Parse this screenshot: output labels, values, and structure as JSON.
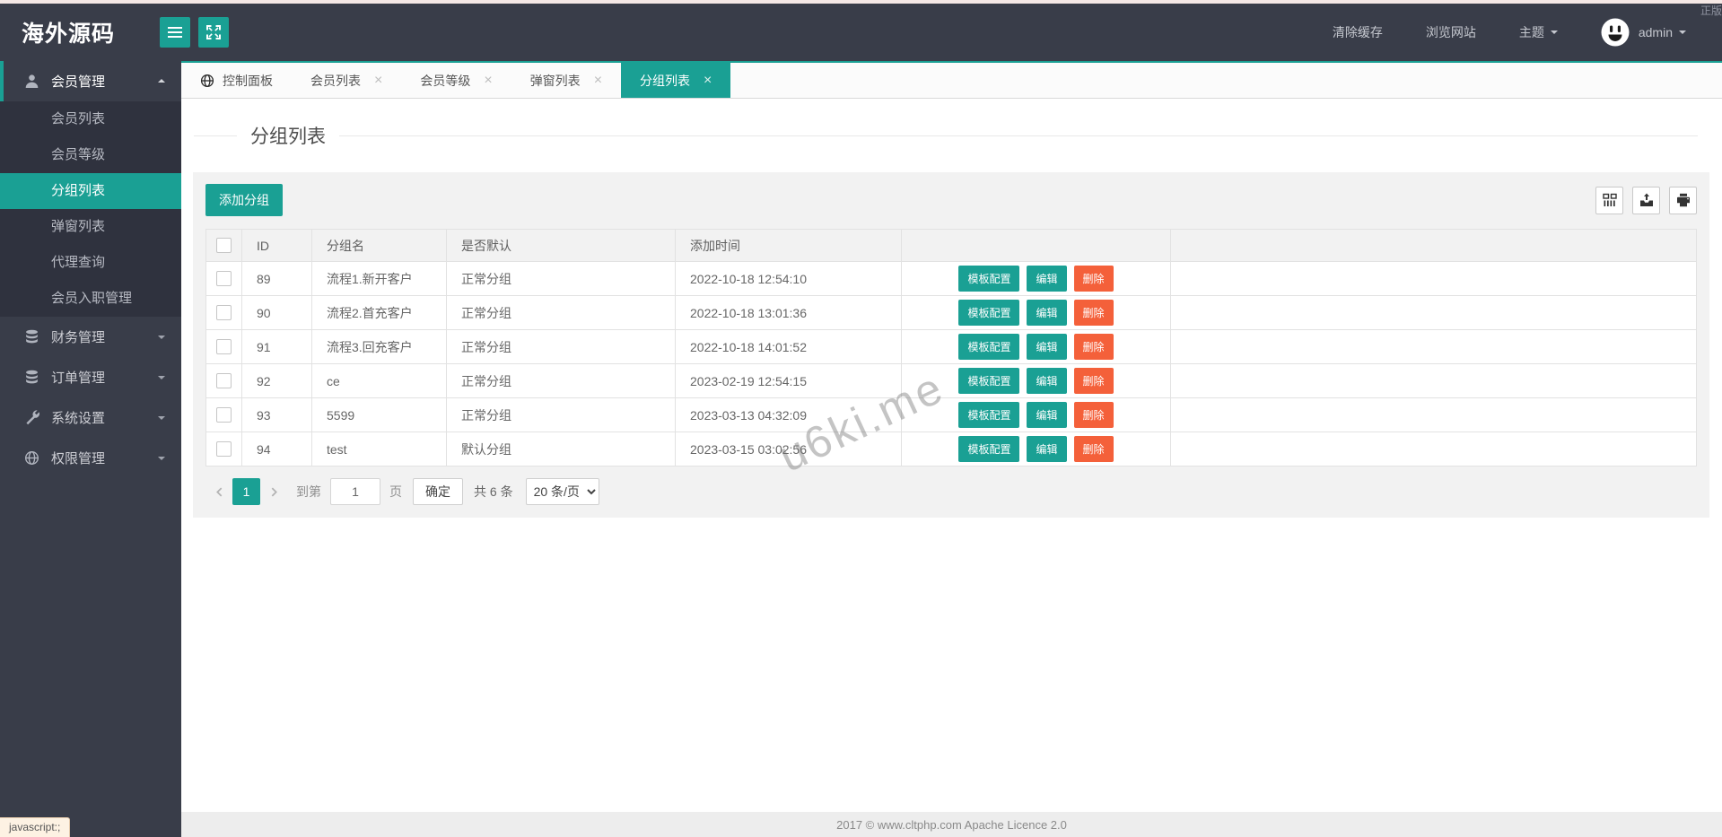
{
  "topbar": {
    "logo": "海外源码",
    "corner_text": "正版",
    "clear_cache": "清除缓存",
    "view_site": "浏览网站",
    "theme_label": "主题",
    "username": "admin"
  },
  "sidebar": {
    "sections": [
      {
        "key": "member-management",
        "label": "会员管理",
        "icon": "user-icon",
        "expanded": true,
        "active": true,
        "children": [
          {
            "key": "member-list",
            "label": "会员列表",
            "active": false
          },
          {
            "key": "member-level",
            "label": "会员等级",
            "active": false
          },
          {
            "key": "group-list",
            "label": "分组列表",
            "active": true
          },
          {
            "key": "popup-list",
            "label": "弹窗列表",
            "active": false
          },
          {
            "key": "agent-query",
            "label": "代理查询",
            "active": false
          },
          {
            "key": "member-entry-management",
            "label": "会员入职管理",
            "active": false
          }
        ]
      },
      {
        "key": "finance-management",
        "label": "财务管理",
        "icon": "database-icon",
        "expanded": false,
        "active": false
      },
      {
        "key": "order-management",
        "label": "订单管理",
        "icon": "database-icon",
        "expanded": false,
        "active": false
      },
      {
        "key": "system-settings",
        "label": "系统设置",
        "icon": "wrench-icon",
        "expanded": false,
        "active": false
      },
      {
        "key": "permission-management",
        "label": "权限管理",
        "icon": "globe-icon",
        "expanded": false,
        "active": false
      }
    ]
  },
  "tabs": [
    {
      "key": "dashboard",
      "label": "控制面板",
      "icon": "globe-icon",
      "closable": false,
      "active": false
    },
    {
      "key": "member-list",
      "label": "会员列表",
      "closable": true,
      "active": false
    },
    {
      "key": "member-level",
      "label": "会员等级",
      "closable": true,
      "active": false
    },
    {
      "key": "popup-list",
      "label": "弹窗列表",
      "closable": true,
      "active": false
    },
    {
      "key": "group-list",
      "label": "分组列表",
      "closable": true,
      "active": true
    }
  ],
  "ui": {
    "close_glyph": "×"
  },
  "page": {
    "title": "分组列表"
  },
  "toolbar": {
    "add_button": "添加分组"
  },
  "table": {
    "headers": [
      "ID",
      "分组名",
      "是否默认",
      "添加时间"
    ],
    "action_buttons": [
      "模板配置",
      "编辑",
      "删除"
    ],
    "rows": [
      {
        "id": "89",
        "name": "流程1.新开客户",
        "default": "正常分组",
        "time": "2022-10-18 12:54:10"
      },
      {
        "id": "90",
        "name": "流程2.首充客户",
        "default": "正常分组",
        "time": "2022-10-18 13:01:36"
      },
      {
        "id": "91",
        "name": "流程3.回充客户",
        "default": "正常分组",
        "time": "2022-10-18 14:01:52"
      },
      {
        "id": "92",
        "name": "ce",
        "default": "正常分组",
        "time": "2023-02-19 12:54:15"
      },
      {
        "id": "93",
        "name": "5599",
        "default": "正常分组",
        "time": "2023-03-13 04:32:09"
      },
      {
        "id": "94",
        "name": "test",
        "default": "默认分组",
        "time": "2023-03-15 03:02:56"
      }
    ]
  },
  "pagination": {
    "current_page": "1",
    "goto_label": "到第",
    "page_input": "1",
    "page_suffix": "页",
    "confirm": "确定",
    "total": "共 6 条",
    "per_page": "20 条/页"
  },
  "watermark": "u6ki.me",
  "footer": "2017 ©  www.cltphp.com  Apache Licence 2.0",
  "statusbar": "javascript:;",
  "colors": {
    "teal": "#1AA094",
    "danger": "#F4603A",
    "dark": "#393D49",
    "dark_sub": "#2F323E"
  }
}
